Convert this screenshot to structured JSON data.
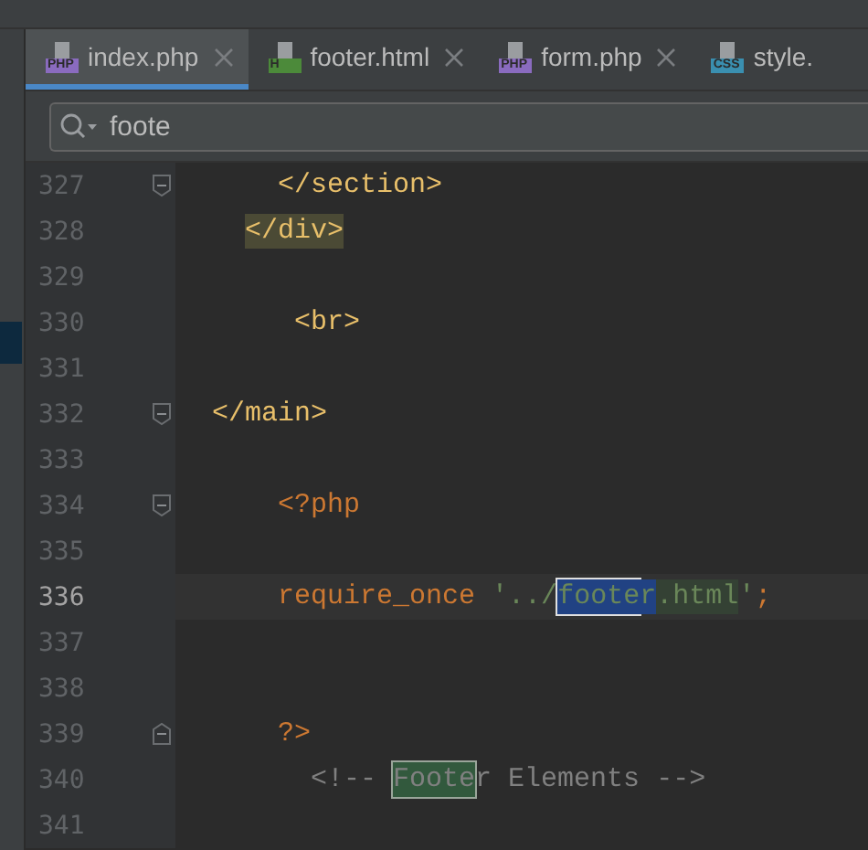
{
  "tabs": [
    {
      "label": "index.php",
      "badge": "PHP",
      "kind": "php",
      "selected": true,
      "closable": true
    },
    {
      "label": "footer.html",
      "badge": "H",
      "kind": "html",
      "selected": false,
      "closable": true
    },
    {
      "label": "form.php",
      "badge": "PHP",
      "kind": "php",
      "selected": false,
      "closable": true
    },
    {
      "label": "style.",
      "badge": "CSS",
      "kind": "css",
      "selected": false,
      "closable": false
    }
  ],
  "search": {
    "value": "foote"
  },
  "lines": [
    {
      "number": "327",
      "current": false,
      "fold": {
        "kind": "start"
      },
      "tokens": [
        {
          "text": "    </section>",
          "kind": "tag"
        }
      ]
    },
    {
      "number": "328",
      "current": false,
      "tokens": [
        {
          "text": "  </div>",
          "kind": "tag",
          "highlight": {
            "kind": "tag-match"
          }
        }
      ]
    },
    {
      "number": "329",
      "current": false
    },
    {
      "number": "330",
      "current": false,
      "tokens": [
        {
          "text": "     <br>",
          "kind": "tag"
        }
      ]
    },
    {
      "number": "331",
      "current": false
    },
    {
      "number": "332",
      "current": false,
      "fold": {
        "kind": "start"
      },
      "tokens": [
        {
          "text": "</main>",
          "kind": "tag"
        }
      ]
    },
    {
      "number": "333",
      "current": false
    },
    {
      "number": "334",
      "current": false,
      "fold": {
        "kind": "start"
      },
      "tokens": [
        {
          "text": "    <?php",
          "kind": "keyword"
        }
      ]
    },
    {
      "number": "335",
      "current": false
    },
    {
      "number": "336",
      "current": true,
      "tokens": [
        {
          "text": "    require_once ",
          "kind": "keyword"
        },
        {
          "text": "'../",
          "kind": "string"
        },
        {
          "text": "foote",
          "kind": "string",
          "highlight": {
            "kind": "current-match"
          }
        },
        {
          "text": "r",
          "kind": "string",
          "highlight": {
            "kind": "selection"
          }
        },
        {
          "text": ".html",
          "kind": "string",
          "highlight": {
            "kind": "usage"
          }
        },
        {
          "text": "'",
          "kind": "string"
        },
        {
          "text": ";",
          "kind": "keyword"
        }
      ]
    },
    {
      "number": "337",
      "current": false
    },
    {
      "number": "338",
      "current": false
    },
    {
      "number": "339",
      "current": false,
      "fold": {
        "kind": "end"
      },
      "tokens": [
        {
          "text": "    ?>",
          "kind": "keyword"
        }
      ]
    },
    {
      "number": "340",
      "current": false,
      "tokens": [
        {
          "text": "      <!-- ",
          "kind": "comment"
        },
        {
          "text": "Foote",
          "kind": "comment",
          "highlight": {
            "kind": "match"
          }
        },
        {
          "text": "r Elements -->",
          "kind": "comment"
        }
      ]
    },
    {
      "number": "341",
      "current": false
    }
  ]
}
